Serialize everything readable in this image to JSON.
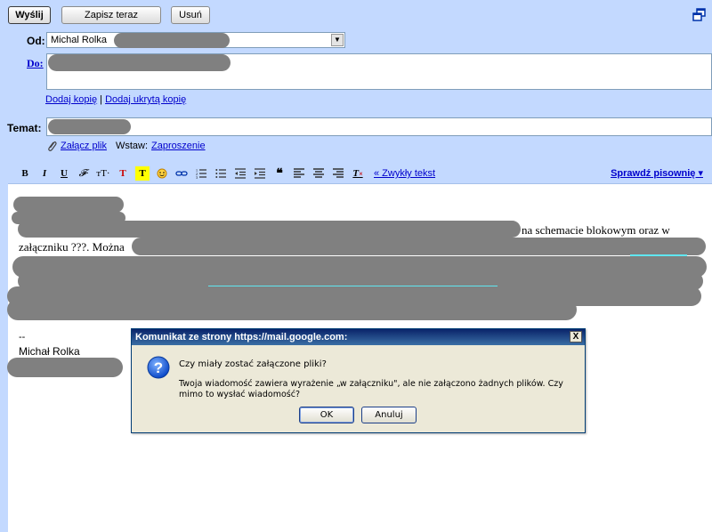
{
  "toolbar": {
    "send_label": "Wyślij",
    "save_label": "Zapisz teraz",
    "delete_label": "Usuń"
  },
  "from": {
    "label": "Od:",
    "value": "Michal Rolka"
  },
  "to": {
    "label": "Do:"
  },
  "cc": {
    "add_cc": "Dodaj kopię",
    "separator": "|",
    "add_bcc": "Dodaj ukrytą kopię"
  },
  "subject": {
    "label": "Temat:"
  },
  "attach": {
    "attach_label": "Załącz plik",
    "insert_label": "Wstaw:",
    "invitation_label": "Zaproszenie"
  },
  "formatting": {
    "plain_text_label": "« Zwykły tekst",
    "spellcheck_label": "Sprawdź pisownię ▾"
  },
  "body": {
    "line1_tail": "na schemacie blokowym oraz w",
    "line2_start": "załączniku ???. Można",
    "sig_dash": "--",
    "sig_name": "Michał Rolka"
  },
  "dialog": {
    "title": "Komunikat ze strony https://mail.google.com:",
    "close": "X",
    "question": "Czy miały zostać załączone pliki?",
    "message": "Twoja wiadomość zawiera wyrażenie „w załączniku\", ale nie załączono żadnych plików. Czy mimo to wysłać wiadomość?",
    "ok_label": "OK",
    "cancel_label": "Anuluj"
  },
  "colors": {
    "compose_bg": "#c3d9ff",
    "link": "#0000cc",
    "dialog_title": "#0a246a",
    "redaction": "#808080"
  }
}
